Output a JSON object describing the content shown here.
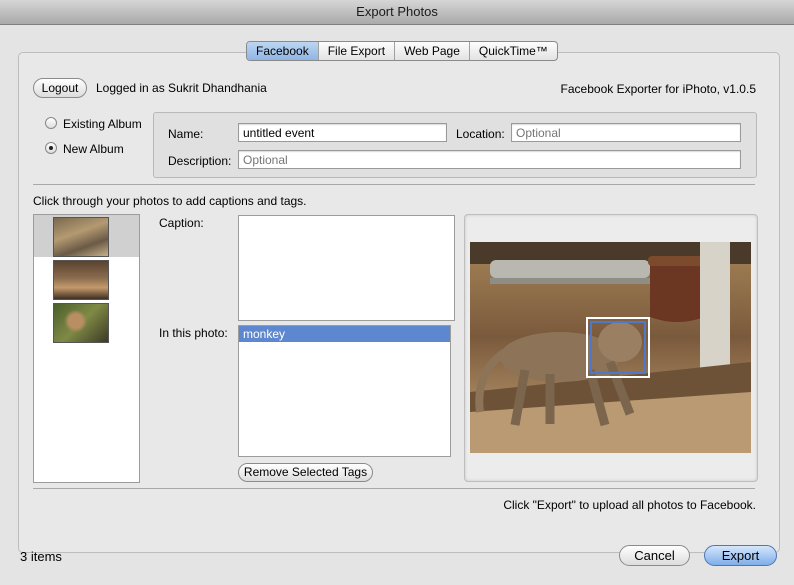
{
  "window": {
    "title": "Export Photos"
  },
  "tabs": [
    "Facebook",
    "File Export",
    "Web Page",
    "QuickTime™"
  ],
  "account": {
    "logout_label": "Logout",
    "status_text": "Logged in as Sukrit Dhandhania",
    "version_text": "Facebook Exporter for iPhoto, v1.0.5"
  },
  "album": {
    "existing_label": "Existing Album",
    "new_label": "New Album",
    "selected": "New Album",
    "name_label": "Name:",
    "name_value": "untitled event",
    "location_label": "Location:",
    "location_placeholder": "Optional",
    "description_label": "Description:",
    "description_placeholder": "Optional"
  },
  "instructions": "Click through your photos to add captions and tags.",
  "photo_editor": {
    "caption_label": "Caption:",
    "caption_value": "",
    "tags_label": "In this photo:",
    "tags": [
      "monkey"
    ],
    "remove_tags_label": "Remove Selected Tags"
  },
  "footer_hint": "Click \"Export\" to upload all photos to Facebook.",
  "bottom": {
    "item_count": "3 items",
    "cancel_label": "Cancel",
    "export_label": "Export"
  }
}
